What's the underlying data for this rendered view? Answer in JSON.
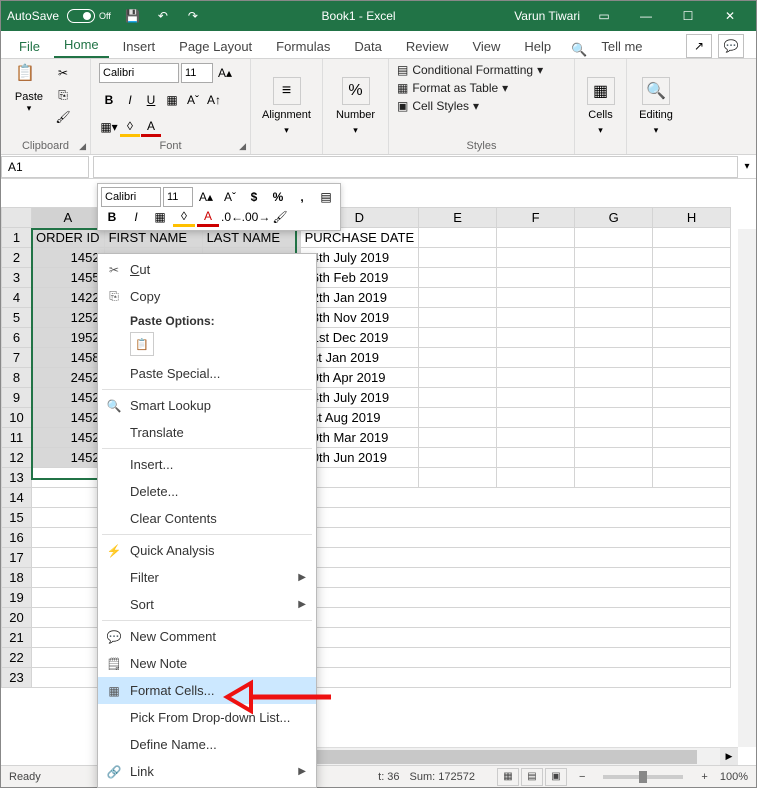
{
  "titlebar": {
    "autosave": "AutoSave",
    "autosave_state": "Off",
    "doc_title": "Book1 - Excel",
    "user": "Varun Tiwari"
  },
  "tabs": {
    "file": "File",
    "home": "Home",
    "insert": "Insert",
    "page_layout": "Page Layout",
    "formulas": "Formulas",
    "data": "Data",
    "review": "Review",
    "view": "View",
    "help": "Help",
    "tell_me": "Tell me"
  },
  "ribbon": {
    "clipboard": {
      "label": "Clipboard",
      "paste": "Paste"
    },
    "font": {
      "label": "Font",
      "name": "Calibri",
      "size": "11"
    },
    "alignment": {
      "label": "Alignment"
    },
    "number": {
      "label": "Number"
    },
    "styles": {
      "label": "Styles",
      "cond": "Conditional Formatting",
      "table": "Format as Table",
      "cell": "Cell Styles"
    },
    "cells": {
      "label": "Cells"
    },
    "editing": {
      "label": "Editing"
    }
  },
  "namebox": "A1",
  "mini": {
    "font": "Calibri",
    "size": "11"
  },
  "context_menu": {
    "cut": "Cut",
    "copy": "Copy",
    "paste_opts": "Paste Options:",
    "paste_special": "Paste Special...",
    "smart_lookup": "Smart Lookup",
    "translate": "Translate",
    "insert": "Insert...",
    "delete": "Delete...",
    "clear": "Clear Contents",
    "quick_analysis": "Quick Analysis",
    "filter": "Filter",
    "sort": "Sort",
    "new_comment": "New Comment",
    "new_note": "New Note",
    "format_cells": "Format Cells...",
    "pick_list": "Pick From Drop-down List...",
    "define_name": "Define Name...",
    "link": "Link"
  },
  "grid": {
    "columns": [
      "A",
      "B",
      "C",
      "D",
      "E",
      "F",
      "G",
      "H"
    ],
    "headers": {
      "a": "ORDER ID",
      "b": "FIRST NAME",
      "c": "LAST NAME",
      "d": "PURCHASE DATE"
    },
    "rows": [
      {
        "id": "1452",
        "date": "24th July 2019"
      },
      {
        "id": "1455",
        "date": "26th Feb 2019"
      },
      {
        "id": "1422",
        "date": "12th Jan 2019"
      },
      {
        "id": "1252",
        "date": "18th Nov 2019"
      },
      {
        "id": "1952",
        "date": "21st Dec 2019"
      },
      {
        "id": "1458",
        "date": "1st Jan 2019"
      },
      {
        "id": "2452",
        "date": "19th Apr 2019"
      },
      {
        "id": "1452",
        "date": "24th July 2019"
      },
      {
        "id": "1452",
        "date": "1st Aug 2019"
      },
      {
        "id": "1452",
        "date": "19th Mar 2019"
      },
      {
        "id": "1452",
        "date": "10th Jun 2019"
      }
    ]
  },
  "statusbar": {
    "ready": "Ready",
    "count": "t: 36",
    "sum": "Sum: 172572",
    "zoom": "100%"
  }
}
